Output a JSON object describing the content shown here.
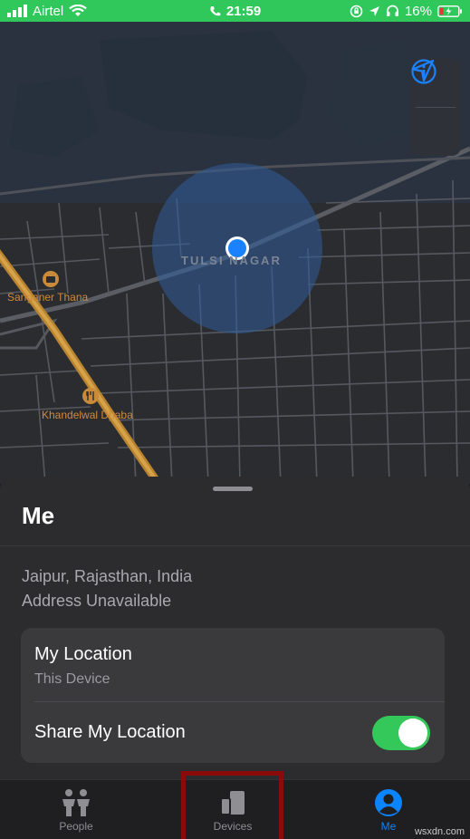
{
  "status_bar": {
    "carrier": "Airtel",
    "time": "21:59",
    "battery": "16%"
  },
  "map": {
    "area_label": "TULSI NAGAR",
    "pois": [
      {
        "name": "Sanganer Thana",
        "icon": "briefcase-icon"
      },
      {
        "name": "Khandelwal Dhaba",
        "icon": "fork-knife-icon"
      }
    ],
    "controls": [
      "info-icon",
      "location-arrow-icon"
    ]
  },
  "sheet": {
    "title": "Me",
    "address_line1": "Jaipur, Rajasthan, India",
    "address_line2": "Address Unavailable",
    "card": {
      "title": "My Location",
      "subtitle": "This Device",
      "share_label": "Share My Location",
      "share_enabled": true
    }
  },
  "tabs": [
    {
      "label": "People",
      "icon": "people-icon",
      "active": false
    },
    {
      "label": "Devices",
      "icon": "devices-icon",
      "active": false
    },
    {
      "label": "Me",
      "icon": "person-circle-icon",
      "active": true
    }
  ],
  "watermark": "wsxdn.com",
  "colors": {
    "accent": "#0a84ff",
    "toggle_on": "#34c759",
    "status_bar": "#30c85a",
    "highlight": "#8b0a0a"
  }
}
